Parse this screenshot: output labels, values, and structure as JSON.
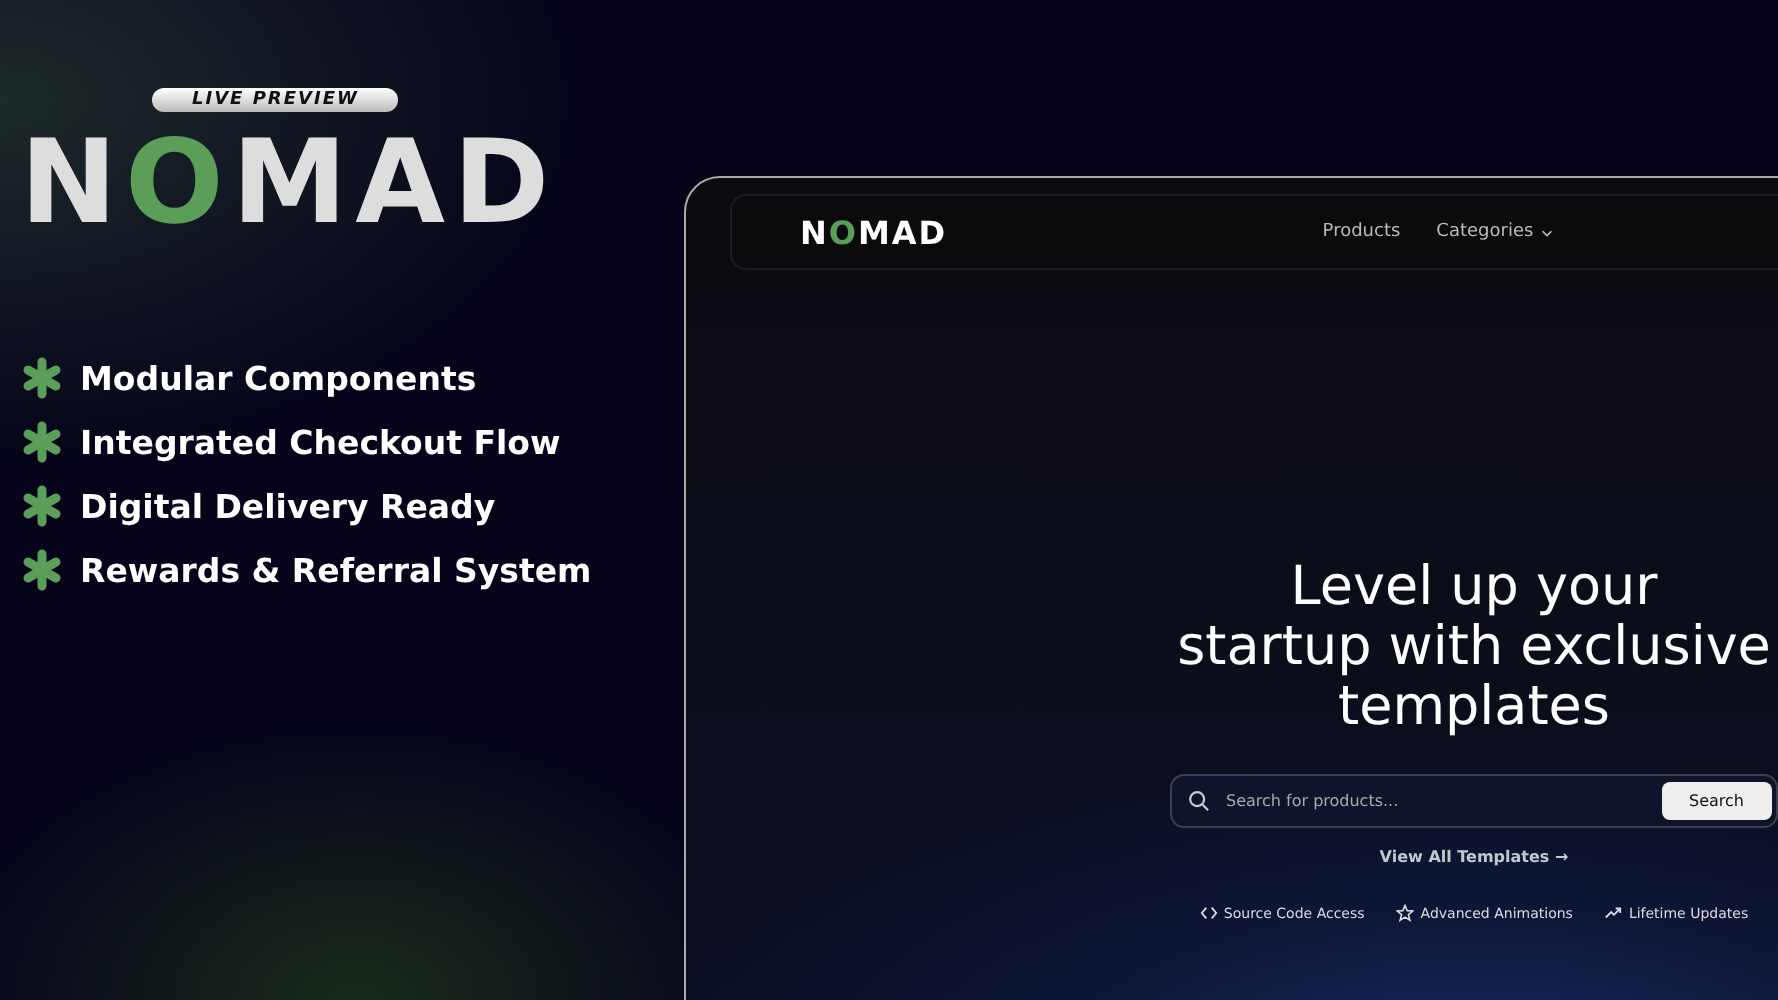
{
  "badge": "LIVE PREVIEW",
  "logo": [
    {
      "text": "N",
      "accent": false
    },
    {
      "text": "O",
      "accent": true
    },
    {
      "text": "MAD",
      "accent": false
    }
  ],
  "features": [
    "Modular Components",
    "Integrated Checkout Flow",
    "Digital Delivery Ready",
    "Rewards & Referral System"
  ],
  "preview": {
    "logo": [
      {
        "text": "N",
        "accent": false
      },
      {
        "text": "O",
        "accent": true
      },
      {
        "text": "MAD",
        "accent": false
      }
    ],
    "nav": [
      {
        "label": "Products",
        "dropdown": false
      },
      {
        "label": "Categories",
        "dropdown": true
      }
    ],
    "headline": [
      "Level up your",
      "startup with exclusive",
      "templates"
    ],
    "search": {
      "placeholder": "Search for products...",
      "button": "Search"
    },
    "link": "View All Templates →",
    "highlights": [
      {
        "kind": "code",
        "label": "Source Code Access"
      },
      {
        "kind": "star",
        "label": "Advanced Animations"
      },
      {
        "kind": "trend",
        "label": "Lifetime Updates"
      }
    ]
  }
}
